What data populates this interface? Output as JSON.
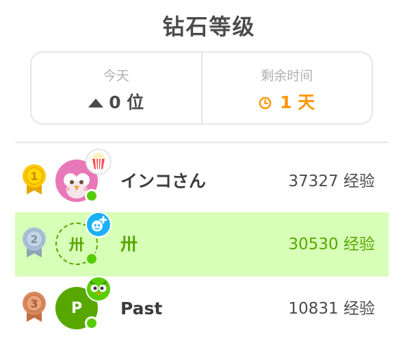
{
  "header": {
    "title": "钻石等级"
  },
  "stats": {
    "today": {
      "label": "今天",
      "value": "0 位",
      "icon": "up-triangle-icon"
    },
    "remaining": {
      "label": "剩余时间",
      "value": "1 天",
      "icon": "clock-icon"
    }
  },
  "colors": {
    "accent_green": "#58a700",
    "highlight_bg": "#d7ffb8",
    "orange": "#ff9600",
    "gold": "#ffc800",
    "silver": "#a8c0d6",
    "bronze": "#d9885b",
    "online": "#58cc02"
  },
  "leaderboard": {
    "rows": [
      {
        "rank": "1",
        "name": "インコさん",
        "xp": "37327 经验",
        "avatar_icon": "pink-bird-avatar-icon",
        "badge_icon": "popcorn-icon"
      },
      {
        "rank": "2",
        "name": "卅",
        "avatar_text": "卅",
        "xp": "30530 经验",
        "badge_icon": "add-friend-icon"
      },
      {
        "rank": "3",
        "name": "Past",
        "avatar_text": "P",
        "xp": "10831 经验",
        "badge_icon": "duo-owl-icon"
      }
    ]
  }
}
